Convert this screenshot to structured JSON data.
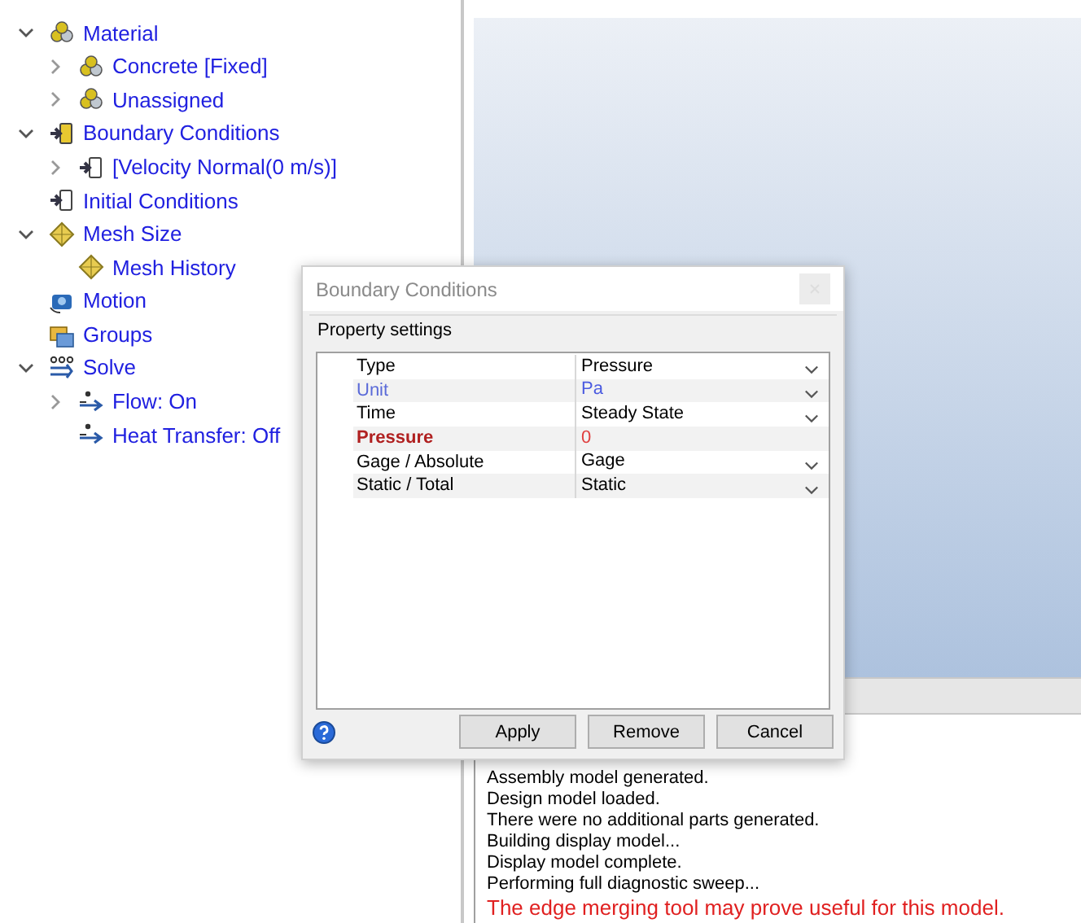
{
  "tree": [
    {
      "label": "Material",
      "kind": "material",
      "expanded": true,
      "children": [
        {
          "label": "Concrete [Fixed]",
          "kind": "material",
          "expanded": false
        },
        {
          "label": "Unassigned",
          "kind": "material",
          "expanded": false
        }
      ]
    },
    {
      "label": "Boundary Conditions",
      "kind": "boundary",
      "expanded": true,
      "children": [
        {
          "label": "[Velocity Normal(0 m/s)]",
          "kind": "boundary_item",
          "expanded": false
        }
      ]
    },
    {
      "label": "Initial Conditions",
      "kind": "boundary_item"
    },
    {
      "label": "Mesh Size",
      "kind": "mesh",
      "expanded": true,
      "children": [
        {
          "label": "Mesh History",
          "kind": "mesh"
        }
      ]
    },
    {
      "label": "Motion",
      "kind": "motion"
    },
    {
      "label": "Groups",
      "kind": "groups"
    },
    {
      "label": "Solve",
      "kind": "solve",
      "expanded": true,
      "children": [
        {
          "label": "Flow: On",
          "kind": "flow",
          "expanded": false
        },
        {
          "label": "Heat Transfer: Off",
          "kind": "flow"
        }
      ]
    }
  ],
  "log": [
    {
      "text": "Assembly model generated.",
      "kind": "info"
    },
    {
      "text": "Design model loaded.",
      "kind": "info"
    },
    {
      "text": "There were no additional parts generated.",
      "kind": "info"
    },
    {
      "text": "Building display model...",
      "kind": "info"
    },
    {
      "text": "Display model complete.",
      "kind": "info"
    },
    {
      "text": "Performing full diagnostic sweep...",
      "kind": "info"
    },
    {
      "text": "The edge merging tool may prove useful for this model.",
      "kind": "warning"
    }
  ],
  "dialog": {
    "title": "Boundary Conditions",
    "group": "Property settings",
    "properties": [
      {
        "name": "Type",
        "value": "Pressure",
        "kind": "normal",
        "dropdown": true
      },
      {
        "name": "Unit",
        "value": "Pa",
        "kind": "unit",
        "dropdown": true
      },
      {
        "name": "Time",
        "value": "Steady State",
        "kind": "normal",
        "dropdown": true
      },
      {
        "name": "Pressure",
        "value": "0",
        "kind": "required",
        "dropdown": false
      },
      {
        "name": "Gage / Absolute",
        "value": "Gage",
        "kind": "normal",
        "dropdown": true
      },
      {
        "name": "Static / Total",
        "value": "Static",
        "kind": "normal",
        "dropdown": true
      }
    ],
    "buttons": [
      "Apply",
      "Remove",
      "Cancel"
    ]
  }
}
